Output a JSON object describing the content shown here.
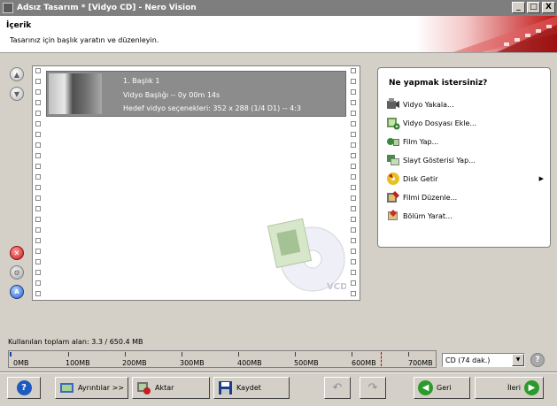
{
  "window": {
    "title": "Adsız Tasarım * [Vidyo CD] - Nero Vision",
    "minimize": "_",
    "maximize": "□",
    "close": "X"
  },
  "header": {
    "title": "İçerik",
    "subtitle": "Tasarınız için başlık yaratın ve düzenleyin."
  },
  "side_buttons": [
    {
      "name": "move-up",
      "icon": "arrow-up-icon"
    },
    {
      "name": "move-down",
      "icon": "arrow-down-icon"
    },
    {
      "name": "delete",
      "icon": "delete-icon"
    },
    {
      "name": "settings",
      "icon": "gear-icon"
    },
    {
      "name": "auto",
      "icon": "auto-icon",
      "glyph": "A"
    }
  ],
  "titles": [
    {
      "name": "1. Başlık 1",
      "duration": "Vidyo Başlığı -- 0y 00m 14s",
      "settings": "Hedef vidyo seçenekleri: 352 x 288 (1/4 D1) -- 4:3"
    }
  ],
  "tasks": {
    "heading": "Ne yapmak istersiniz?",
    "items": [
      {
        "label": "Vidyo Yakala...",
        "icon": "camera-icon"
      },
      {
        "label": "Vidyo Dosyası Ekle...",
        "icon": "add-video-icon"
      },
      {
        "label": "Film Yap...",
        "icon": "film-icon"
      },
      {
        "label": "Slayt Gösterisi Yap...",
        "icon": "slideshow-icon"
      },
      {
        "label": "Disk Getir",
        "icon": "disc-icon",
        "submenu": "▶"
      },
      {
        "label": "Filmi Düzenle...",
        "icon": "edit-film-icon"
      },
      {
        "label": "Bölüm Yarat...",
        "icon": "chapter-icon"
      }
    ]
  },
  "capacity": {
    "used_label": "Kullanılan toplam alan: 3.3 / 650.4 MB",
    "used_mb": 3.3,
    "total_mb": 650.4,
    "ticks": [
      "0MB",
      "100MB",
      "200MB",
      "300MB",
      "400MB",
      "500MB",
      "600MB",
      "700MB"
    ],
    "selected": "CD (74 dak.)",
    "help": "?"
  },
  "buttons": {
    "help": "?",
    "details": "Ayrıntılar >>",
    "export": "Aktar",
    "save": "Kaydet",
    "back": "Geri",
    "next": "İleri"
  }
}
